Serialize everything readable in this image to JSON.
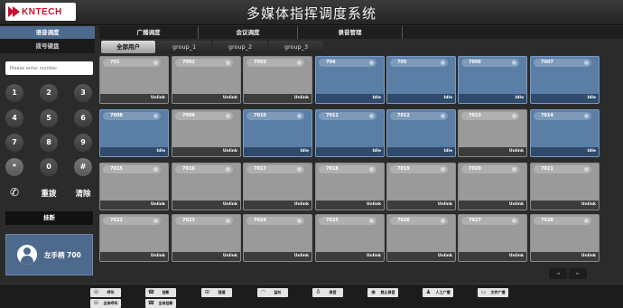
{
  "header": {
    "logo_text": "KNTECH",
    "title": "多媒体指挥调度系统"
  },
  "left": {
    "tabs": [
      {
        "label": "语音调度"
      },
      {
        "label": "拨号键盘"
      }
    ],
    "search_placeholder": "Please enter number",
    "keys": [
      "1",
      "2",
      "3",
      "4",
      "5",
      "6",
      "7",
      "8",
      "9",
      "*",
      "0",
      "#"
    ],
    "redial": "重拨",
    "clear": "清除",
    "hangup": "挂断",
    "handset_label": "左手柄 700"
  },
  "top_tabs": [
    {
      "label": "广播调度"
    },
    {
      "label": "会议调度"
    },
    {
      "label": "录音管理"
    }
  ],
  "group_tabs": [
    {
      "label": "全部用户"
    },
    {
      "label": "group_1"
    },
    {
      "label": "group_2"
    },
    {
      "label": "group_3"
    }
  ],
  "tiles": [
    {
      "number": "701",
      "status": "Unlink"
    },
    {
      "number": "7002",
      "status": "Unlink"
    },
    {
      "number": "7003",
      "status": "Unlink"
    },
    {
      "number": "704",
      "status": "Idle"
    },
    {
      "number": "705",
      "status": "Idle"
    },
    {
      "number": "7006",
      "status": "Idle"
    },
    {
      "number": "7007",
      "status": "Idle"
    },
    {
      "number": "7008",
      "status": "Idle"
    },
    {
      "number": "7009",
      "status": "Unlink"
    },
    {
      "number": "7010",
      "status": "Idle"
    },
    {
      "number": "7011",
      "status": "Idle"
    },
    {
      "number": "7012",
      "status": "Idle"
    },
    {
      "number": "7013",
      "status": "Unlink"
    },
    {
      "number": "7014",
      "status": "Idle"
    },
    {
      "number": "7015",
      "status": "Unlink"
    },
    {
      "number": "7016",
      "status": "Unlink"
    },
    {
      "number": "7017",
      "status": "Unlink"
    },
    {
      "number": "7018",
      "status": "Unlink"
    },
    {
      "number": "7019",
      "status": "Unlink"
    },
    {
      "number": "7020",
      "status": "Unlink"
    },
    {
      "number": "7021",
      "status": "Unlink"
    },
    {
      "number": "7022",
      "status": "Unlink"
    },
    {
      "number": "7023",
      "status": "Unlink"
    },
    {
      "number": "7024",
      "status": "Unlink"
    },
    {
      "number": "7025",
      "status": "Unlink"
    },
    {
      "number": "7026",
      "status": "Unlink"
    },
    {
      "number": "7027",
      "status": "Unlink"
    },
    {
      "number": "7028",
      "status": "Unlink"
    }
  ],
  "pager": {
    "prev": "◄",
    "next": "►"
  },
  "footer": [
    {
      "label": "呼叫",
      "icon": "phone-icon"
    },
    {
      "label": "挂断",
      "icon": "hangup-icon"
    },
    {
      "label": "强插",
      "icon": "cart-icon"
    },
    {
      "label": "监听",
      "icon": "headphones-icon"
    },
    {
      "label": "录音",
      "icon": "mic-icon"
    },
    {
      "label": "禁止录音",
      "icon": "record-icon"
    },
    {
      "label": "人工广播",
      "icon": "user-icon"
    },
    {
      "label": "文件广播",
      "icon": "folder-icon"
    },
    {
      "label": "全体呼叫",
      "icon": "group-call-icon"
    },
    {
      "label": "全体挂断",
      "icon": "group-hangup-icon"
    }
  ],
  "colors": {
    "idle": "#5a7ea6",
    "unlink": "#9a9a9a",
    "accent": "#4d6a8c",
    "logo": "#c8102e"
  }
}
